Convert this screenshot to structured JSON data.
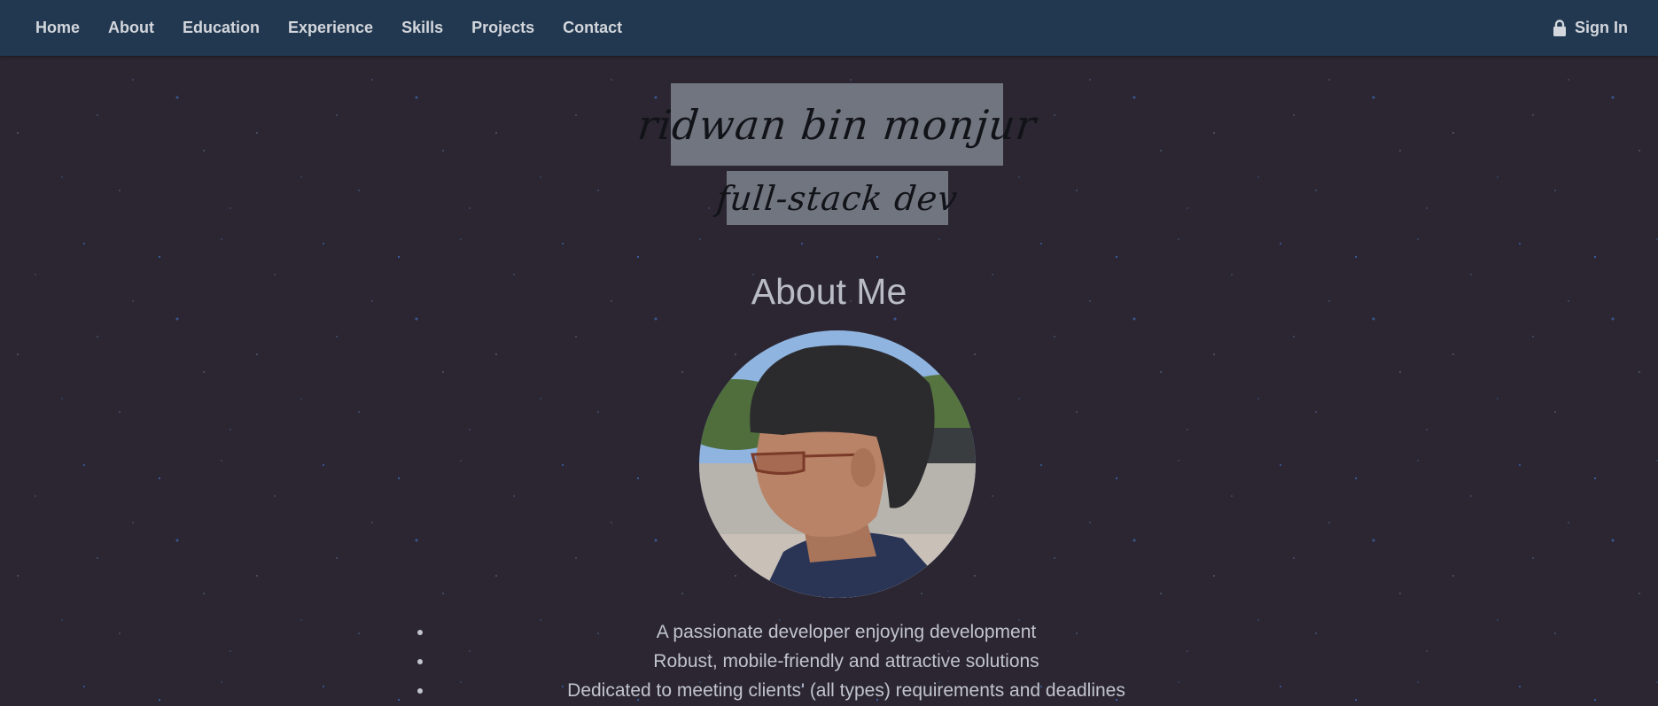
{
  "nav": {
    "items": [
      {
        "label": "Home"
      },
      {
        "label": "About"
      },
      {
        "label": "Education"
      },
      {
        "label": "Experience"
      },
      {
        "label": "Skills"
      },
      {
        "label": "Projects"
      },
      {
        "label": "Contact"
      }
    ],
    "sign_in": {
      "label": "Sign In",
      "icon": "lock-icon"
    }
  },
  "hero": {
    "name": "ridwan bin monjur",
    "role": "full-stack dev"
  },
  "about": {
    "heading": "About Me",
    "points": [
      "A passionate developer enjoying development",
      "Robust, mobile-friendly and attractive solutions",
      "Dedicated to meeting clients' (all types) requirements and deadlines"
    ]
  },
  "colors": {
    "navbar": "#213850",
    "background": "#2b2631",
    "label_box": "#70757f",
    "text": "#c1c4cd"
  }
}
